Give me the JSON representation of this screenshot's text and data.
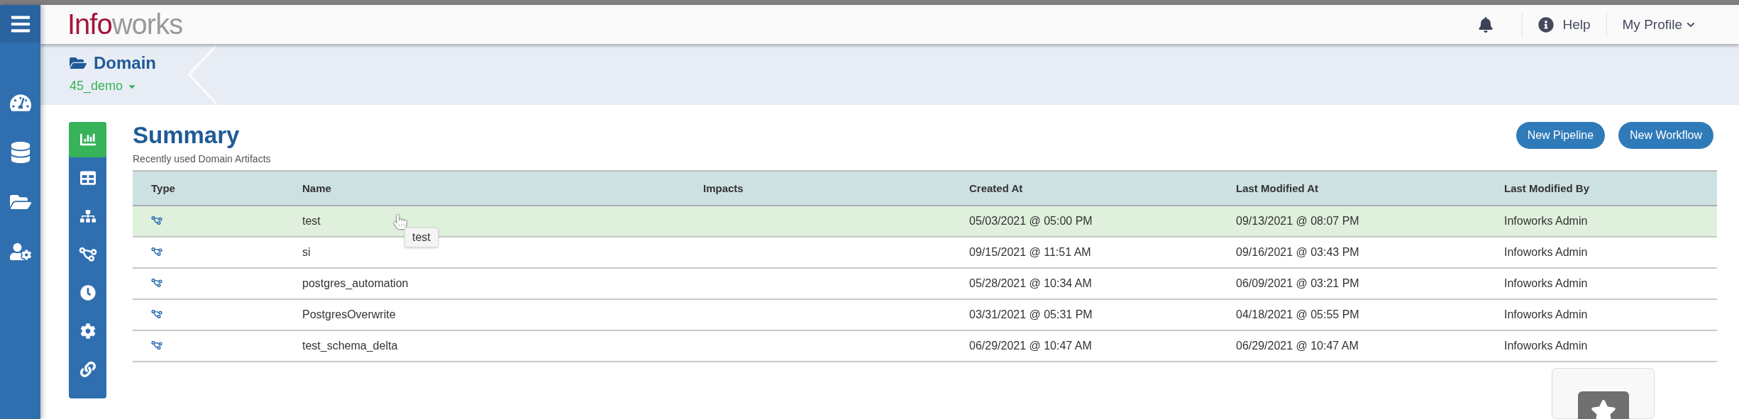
{
  "header": {
    "logo": [
      "Info",
      "works"
    ],
    "help": "Help",
    "profile": "My Profile"
  },
  "breadcrumb": {
    "title": "Domain",
    "domain": "45_demo"
  },
  "tools": [
    {
      "selected": true
    },
    {
      "selected": false
    },
    {
      "selected": false
    },
    {
      "selected": false
    },
    {
      "selected": false
    },
    {
      "selected": false
    },
    {
      "selected": false
    }
  ],
  "summary": {
    "title": "Summary",
    "subtitle": "Recently used Domain Artifacts",
    "buttons": [
      "New Pipeline",
      "New Workflow"
    ]
  },
  "table": {
    "columns": [
      "Type",
      "Name",
      "Impacts",
      "Created At",
      "Last Modified At",
      "Last Modified By"
    ],
    "rows": [
      {
        "name": "test",
        "created": "05/03/2021 @ 05:00 PM",
        "modified": "09/13/2021 @ 08:07 PM",
        "by": "Infoworks Admin",
        "selected": true
      },
      {
        "name": "si",
        "created": "09/15/2021 @ 11:51 AM",
        "modified": "09/16/2021 @ 03:43 PM",
        "by": "Infoworks Admin",
        "selected": false
      },
      {
        "name": "postgres_automation",
        "created": "05/28/2021 @ 10:34 AM",
        "modified": "06/09/2021 @ 03:21 PM",
        "by": "Infoworks Admin",
        "selected": false
      },
      {
        "name": "PostgresOverwrite",
        "created": "03/31/2021 @ 05:31 PM",
        "modified": "04/18/2021 @ 05:55 PM",
        "by": "Infoworks Admin",
        "selected": false
      },
      {
        "name": "test_schema_delta",
        "created": "06/29/2021 @ 10:47 AM",
        "modified": "06/29/2021 @ 10:47 AM",
        "by": "Infoworks Admin",
        "selected": false
      }
    ]
  },
  "tooltip": "test"
}
